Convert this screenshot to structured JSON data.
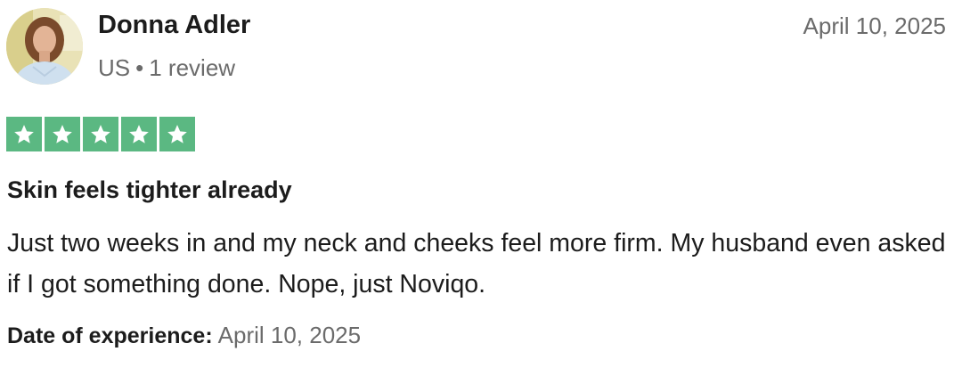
{
  "reviewer": {
    "name": "Donna Adler",
    "country": "US",
    "separator": "•",
    "review_count": "1 review"
  },
  "review": {
    "date": "April 10, 2025",
    "rating": 5,
    "rating_max": 5,
    "star_color": "#5bb882",
    "title": "Skin feels tighter already",
    "body": "Just two weeks in and my neck and cheeks feel more firm. My husband even asked if I got something done. Nope, just Noviqo.",
    "experience_label": "Date of experience:",
    "experience_date": "April 10, 2025"
  },
  "icons": {
    "star": "star-icon",
    "avatar": "avatar-photo"
  }
}
